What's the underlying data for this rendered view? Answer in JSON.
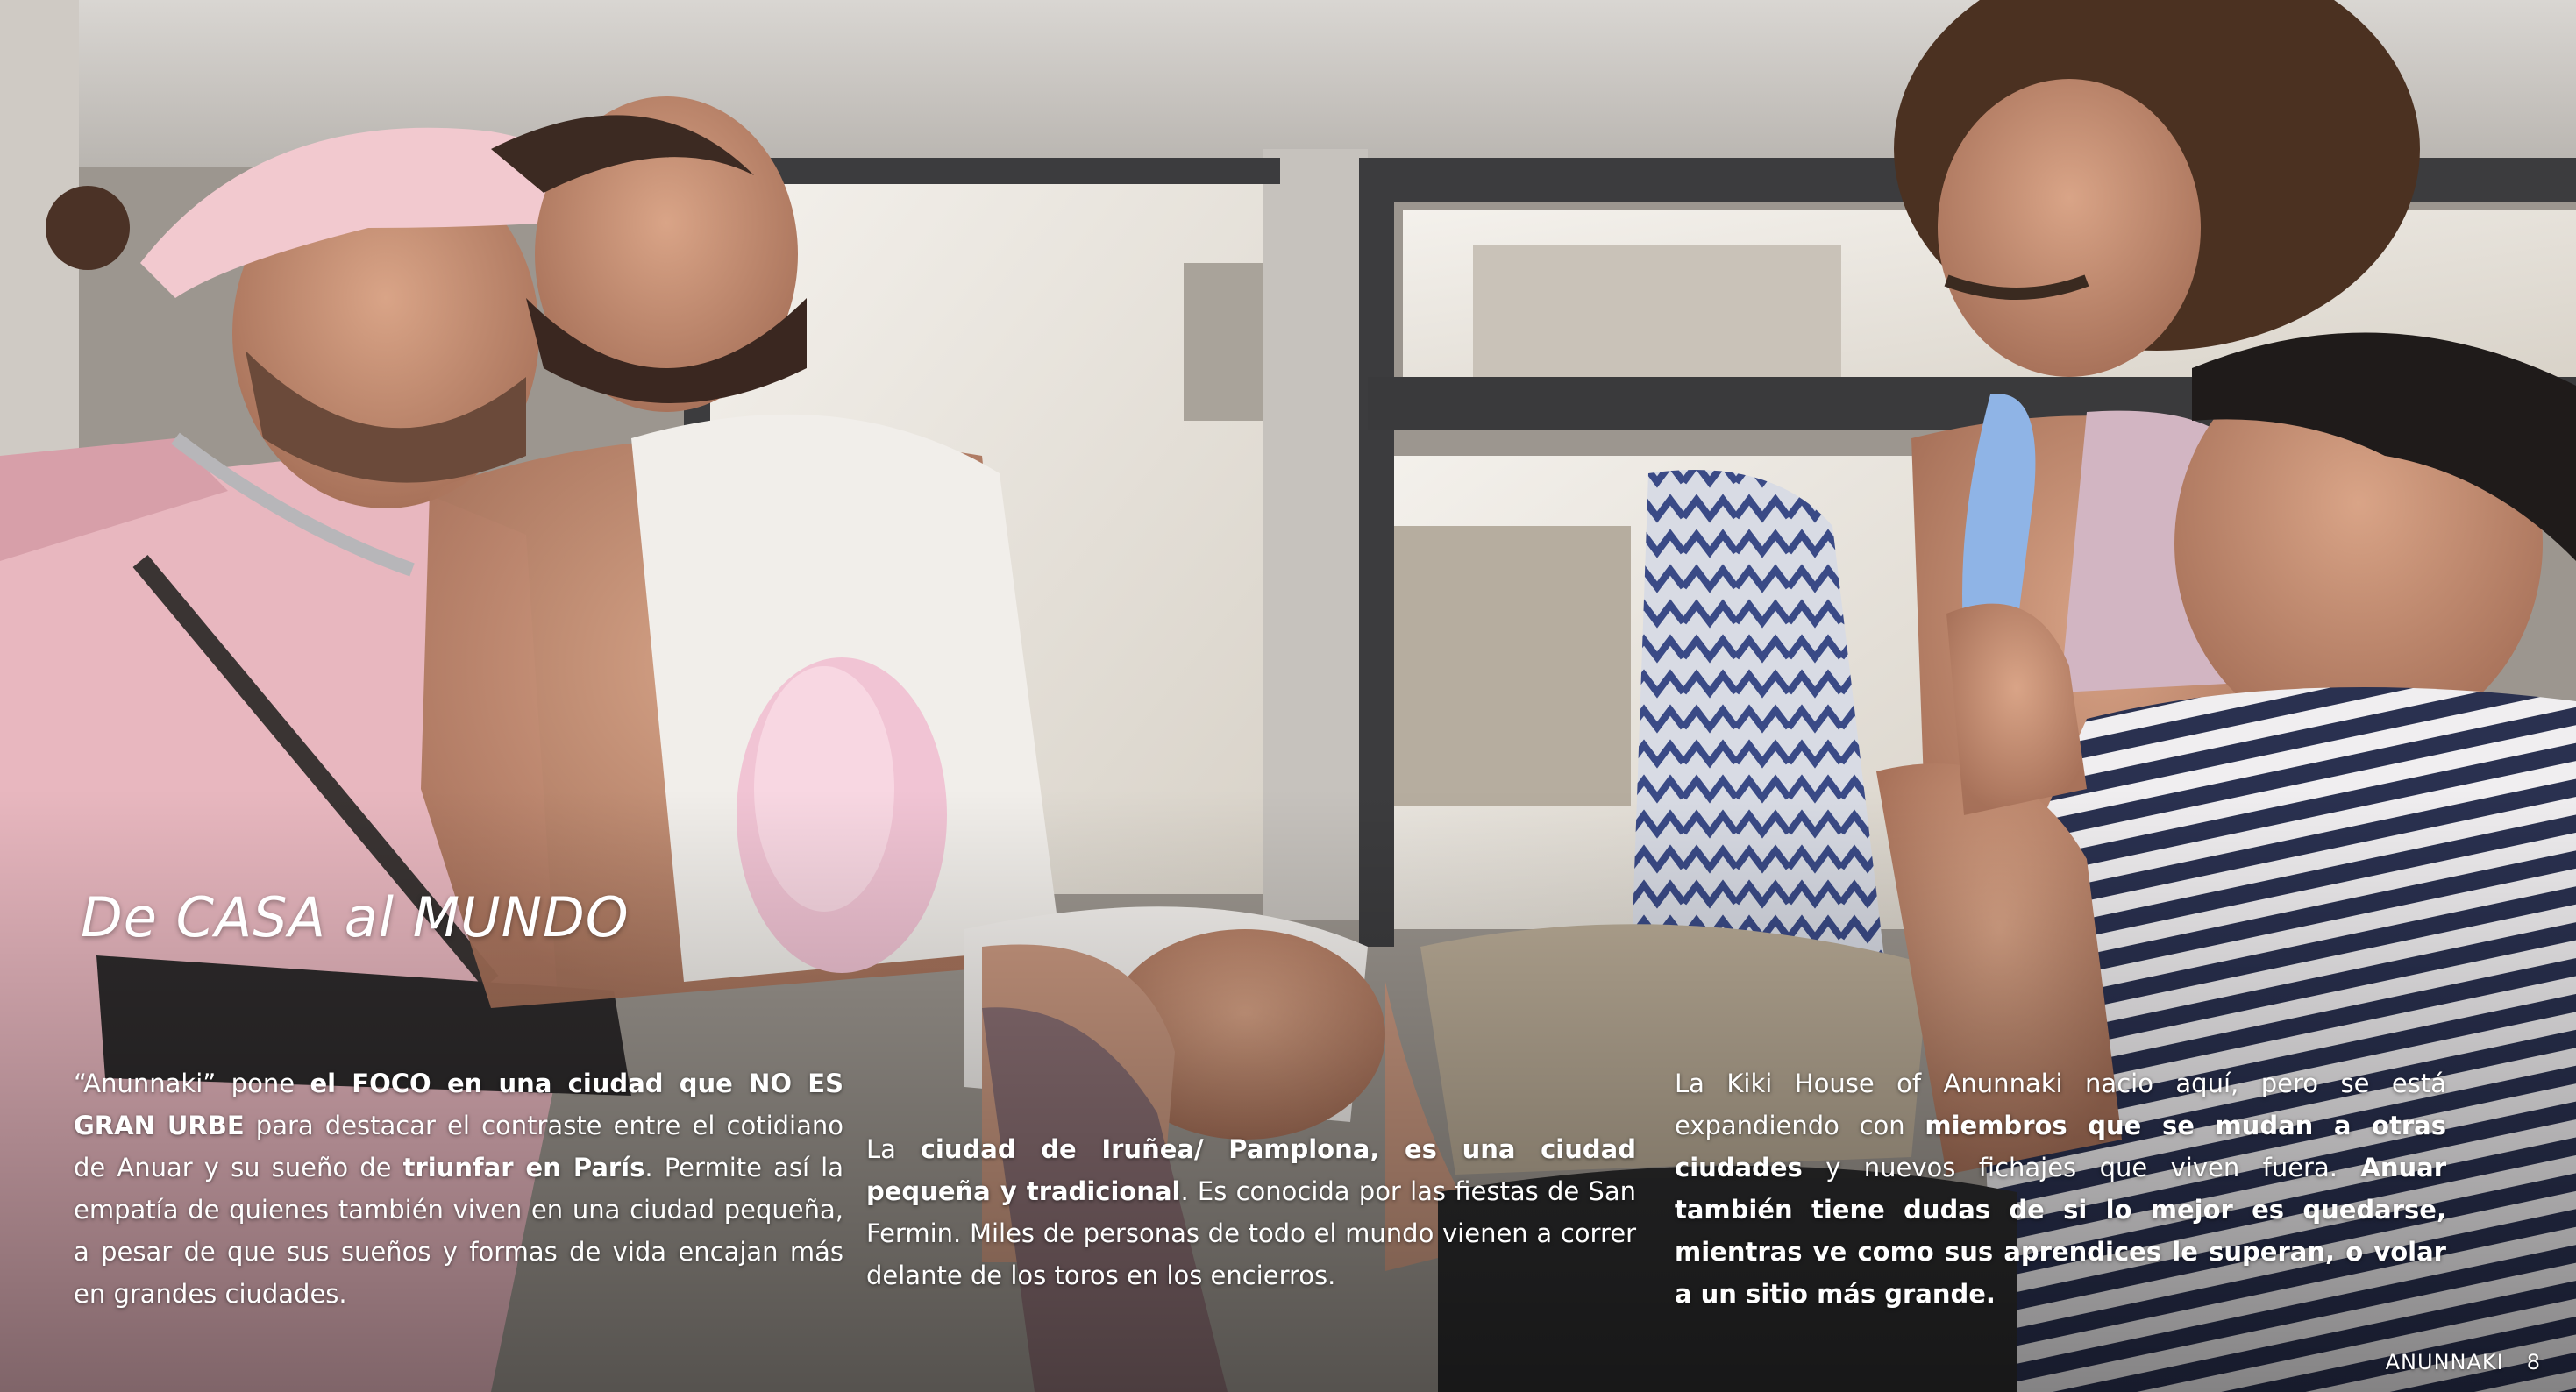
{
  "heading": "De CASA al MUNDO",
  "column1": {
    "t1": "“Anunnaki” pone ",
    "b1": "el FOCO en una ciudad que NO ES GRAN URBE",
    "t2": " para destacar el contraste entre el cotidiano de Anuar y su sueño de ",
    "b2": "triunfar en París",
    "t3": ". Permite así la empatía de quienes también viven en una ciudad pequeña, a pesar de que sus sueños y formas de vida encajan más en grandes ciudades."
  },
  "column2": {
    "t1": "La ",
    "b1": "ciudad de Iruñea/ Pamplona, es una ciudad pequeña y tradicional",
    "t2": ". Es conocida por las fiestas de San Fermin. Miles de personas de todo el mundo vienen a correr delante de los toros en los encierros."
  },
  "column3": {
    "t1": "La Kiki House of Anunnaki nacio aquí, pero se está expandiendo con ",
    "b1": "miembros que se mudan a otras ciudades",
    "t2": " y nuevos fichajes que viven fuera. ",
    "b2": "Anuar también tiene dudas de si lo mejor es quedarse, mientras ve como sus aprendices le superan, o volar a un sitio más grande."
  },
  "footer": {
    "label": "ANUNNAKI",
    "page": "8"
  },
  "colors": {
    "text": "#ffffff",
    "shirt_pink": "#e8b7bf",
    "dress_white": "#f1eeea",
    "stripes_navy": "#2a3150"
  }
}
